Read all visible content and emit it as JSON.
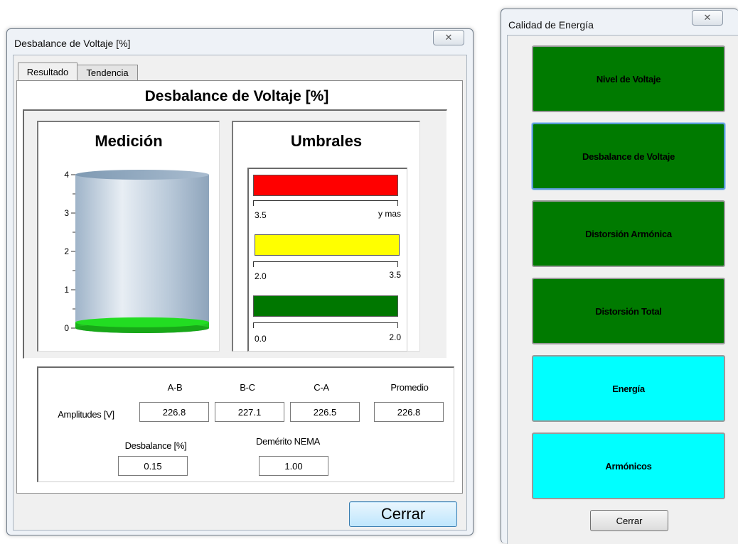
{
  "left_window": {
    "title": "Desbalance de Voltaje [%]",
    "close_glyph": "✕",
    "tabs": [
      {
        "label": "Resultado",
        "active": true
      },
      {
        "label": "Tendencia",
        "active": false
      }
    ],
    "heading": "Desbalance de Voltaje [%]",
    "medicion": {
      "title": "Medición",
      "axis_ticks": [
        "4",
        "3",
        "2",
        "1",
        "0"
      ],
      "level_value": 0.15,
      "axis_max": 4,
      "fill_color": "#22dd22"
    },
    "umbrales": {
      "title": "Umbrales",
      "bands": [
        {
          "color": "#ff0000",
          "low_label": "3.5",
          "high_label": "y mas"
        },
        {
          "color": "#ffff00",
          "low_label": "2.0",
          "high_label": "3.5"
        },
        {
          "color": "#007700",
          "low_label": "0.0",
          "high_label": "2.0"
        }
      ]
    },
    "measurements": {
      "column_headers": [
        "A-B",
        "B-C",
        "C-A",
        "Promedio"
      ],
      "amplitudes_label": "Amplitudes [V]",
      "amplitudes": [
        "226.8",
        "227.1",
        "226.5",
        "226.8"
      ],
      "desbalance_label": "Desbalance [%]",
      "desbalance_value": "0.15",
      "nema_label": "Demérito NEMA",
      "nema_value": "1.00"
    },
    "close_button": "Cerrar"
  },
  "right_window": {
    "title": "Calidad de Energía",
    "close_glyph": "✕",
    "buttons": [
      {
        "label": "Nivel de Voltaje",
        "color": "green"
      },
      {
        "label": "Desbalance de Voltaje",
        "color": "green"
      },
      {
        "label": "Distorsión Armónica",
        "color": "green"
      },
      {
        "label": "Distorsión Total",
        "color": "green"
      },
      {
        "label": "Energía",
        "color": "cyan"
      },
      {
        "label": "Armónicos",
        "color": "cyan"
      }
    ],
    "close_button": "Cerrar"
  }
}
